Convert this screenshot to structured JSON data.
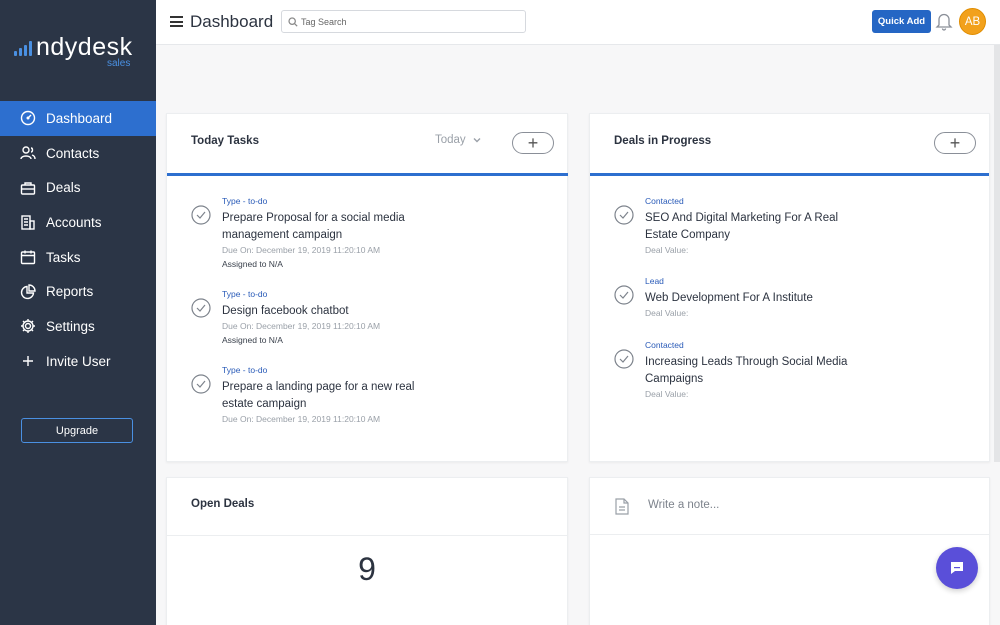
{
  "brand": {
    "name": "ndydesk",
    "sub": "sales",
    "accent": "#4a90e2"
  },
  "sidebar": {
    "items": [
      {
        "label": "Dashboard",
        "icon": "speedometer-icon",
        "active": true
      },
      {
        "label": "Contacts",
        "icon": "contacts-icon"
      },
      {
        "label": "Deals",
        "icon": "deals-icon"
      },
      {
        "label": "Accounts",
        "icon": "building-icon"
      },
      {
        "label": "Tasks",
        "icon": "calendar-icon"
      },
      {
        "label": "Reports",
        "icon": "pie-chart-icon"
      },
      {
        "label": "Settings",
        "icon": "gear-icon"
      },
      {
        "label": "Invite User",
        "icon": "plus-icon"
      }
    ],
    "upgrade_label": "Upgrade"
  },
  "header": {
    "title": "Dashboard",
    "search_placeholder": "Tag Search",
    "quick_add_label": "Quick Add",
    "avatar_initials": "AB"
  },
  "today_tasks": {
    "title": "Today Tasks",
    "filter": "Today",
    "items": [
      {
        "type": "Type - to-do",
        "title": "Prepare Proposal for a social media management campaign",
        "due": "Due On: December 19, 2019 11:20:10 AM",
        "assigned": "Assigned to N/A"
      },
      {
        "type": "Type - to-do",
        "title": "Design facebook chatbot",
        "due": "Due On: December 19, 2019 11:20:10 AM",
        "assigned": "Assigned to N/A"
      },
      {
        "type": "Type - to-do",
        "title": "Prepare a landing page for a new real estate campaign",
        "due": "Due On: December 19, 2019 11:20:10 AM"
      }
    ]
  },
  "deals_in_progress": {
    "title": "Deals in Progress",
    "items": [
      {
        "stage": "Contacted",
        "title": "SEO And Digital Marketing For A Real Estate Company",
        "value": "Deal Value:"
      },
      {
        "stage": "Lead",
        "title": "Web Development For A Institute",
        "value": "Deal Value:"
      },
      {
        "stage": "Contacted",
        "title": "Increasing Leads Through Social Media Campaigns",
        "value": "Deal Value:"
      }
    ]
  },
  "open_deals": {
    "title": "Open Deals",
    "count": "9"
  },
  "notes": {
    "placeholder": "Write a note..."
  },
  "colors": {
    "sidebar": "#2b3546",
    "active": "#2d6fcf",
    "primary_button": "#2566c4",
    "avatar": "#f2a11c",
    "chat": "#5a4fd9"
  }
}
